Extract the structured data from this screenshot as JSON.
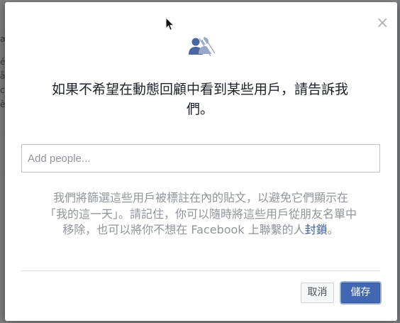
{
  "background": {
    "fragments": [
      "æ",
      "é",
      "å",
      "c",
      "è"
    ]
  },
  "dialog": {
    "close_label": "×",
    "header_icon": "people-hidden-icon",
    "headline": "如果不希望在動態回顧中看到某些用戶，請告訴我們。",
    "search": {
      "placeholder": "Add people...",
      "value": ""
    },
    "explanation": {
      "text": "我們將篩選這些用戶被標註在內的貼文，以避免它們顯示在「我的這一天」。請記住，你可以隨時將這些用戶從朋友名單中移除，也可以將你不想在 Facebook 上聯繫的人",
      "link": "封鎖",
      "tail": "。"
    },
    "buttons": {
      "cancel": "取消",
      "save": "儲存"
    },
    "colors": {
      "link": "#3b5998",
      "primary": "#4267b2",
      "muted_text": "#90949c"
    }
  }
}
